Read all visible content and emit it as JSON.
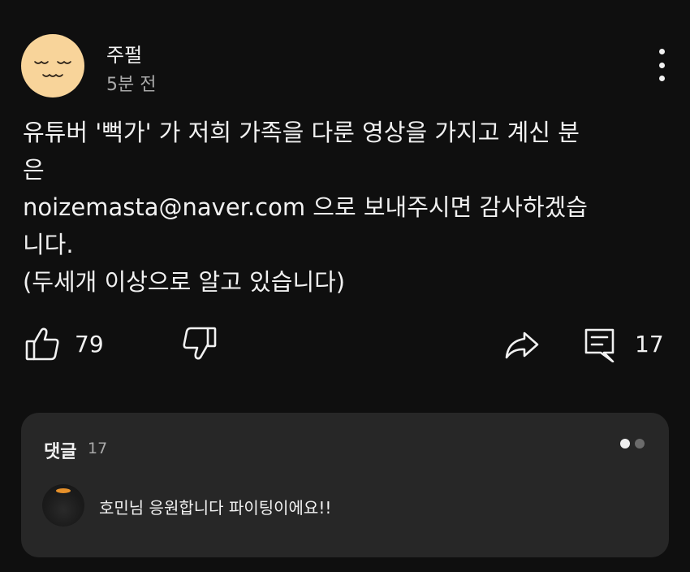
{
  "post": {
    "author": "주펄",
    "time": "5분 전",
    "avatar_icon": "sleepy-face-icon",
    "avatar_color": "#f8d49a",
    "body_lines": [
      "유튜버 '뻑가' 가 저희 가족을 다룬 영상을 가지고 계신 분",
      "은",
      "noizemasta@naver.com 으로 보내주시면 감사하겠습",
      "니다.",
      "(두세개 이상으로 알고 있습니다)"
    ]
  },
  "actions": {
    "like_icon": "thumbs-up-icon",
    "like_count": "79",
    "dislike_icon": "thumbs-down-icon",
    "share_icon": "share-icon",
    "comment_icon": "comment-icon",
    "comment_count": "17"
  },
  "comments": {
    "title": "댓글",
    "count": "17",
    "pager_active_color": "#f1f1f1",
    "pager_inactive_color": "#6b6b6b",
    "first_comment": {
      "text": "호민님 응원합니다 파이팅이에요!!"
    }
  }
}
